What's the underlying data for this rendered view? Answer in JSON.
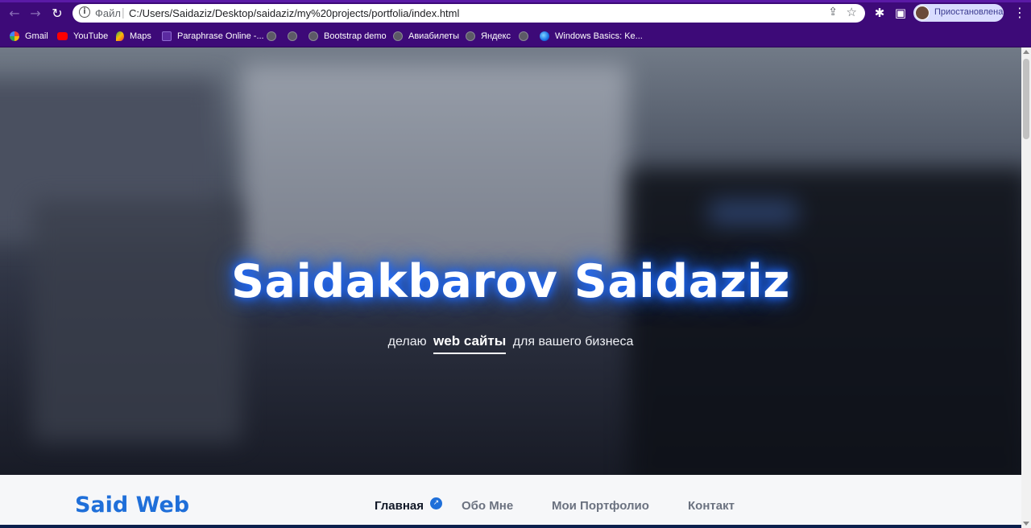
{
  "browser": {
    "omnibox": {
      "file_label": "Файл",
      "separator": "|",
      "url": "C:/Users/Saidaziz/Desktop/saidaziz/my%20projects/portfolia/index.html"
    },
    "profile_label": "Приостановлена",
    "colors": {
      "frame": "#3d0a78",
      "profile_chip": "#d9dcff"
    }
  },
  "bookmarks": [
    {
      "label": "Gmail",
      "icon": "google-icon"
    },
    {
      "label": "YouTube",
      "icon": "youtube-icon"
    },
    {
      "label": "Maps",
      "icon": "maps-icon"
    },
    {
      "label": "Paraphrase Online -...",
      "icon": "paraphrase-icon"
    },
    {
      "label": "",
      "icon": "globe-icon"
    },
    {
      "label": "",
      "icon": "globe-icon"
    },
    {
      "label": "Bootstrap demo",
      "icon": "globe-icon"
    },
    {
      "label": "Авиабилеты",
      "icon": "globe-icon"
    },
    {
      "label": "Яндекс",
      "icon": "globe-icon"
    },
    {
      "label": "",
      "icon": "globe-icon"
    },
    {
      "label": "Windows Basics: Ke...",
      "icon": "gcf-icon"
    }
  ],
  "hero": {
    "title": "Saidakbarov Saidaziz",
    "subtitle_before": "делаю",
    "subtitle_accent": "web сайты",
    "subtitle_after": "для вашего бизнеса",
    "glow_color": "#1f6bff"
  },
  "site_nav": {
    "brand": "Said Web",
    "links": [
      "Главная",
      "Обо Мне",
      "Мои Портфолио",
      "Контакт"
    ],
    "active_index": 0,
    "accent_color": "#1f6fd9"
  }
}
